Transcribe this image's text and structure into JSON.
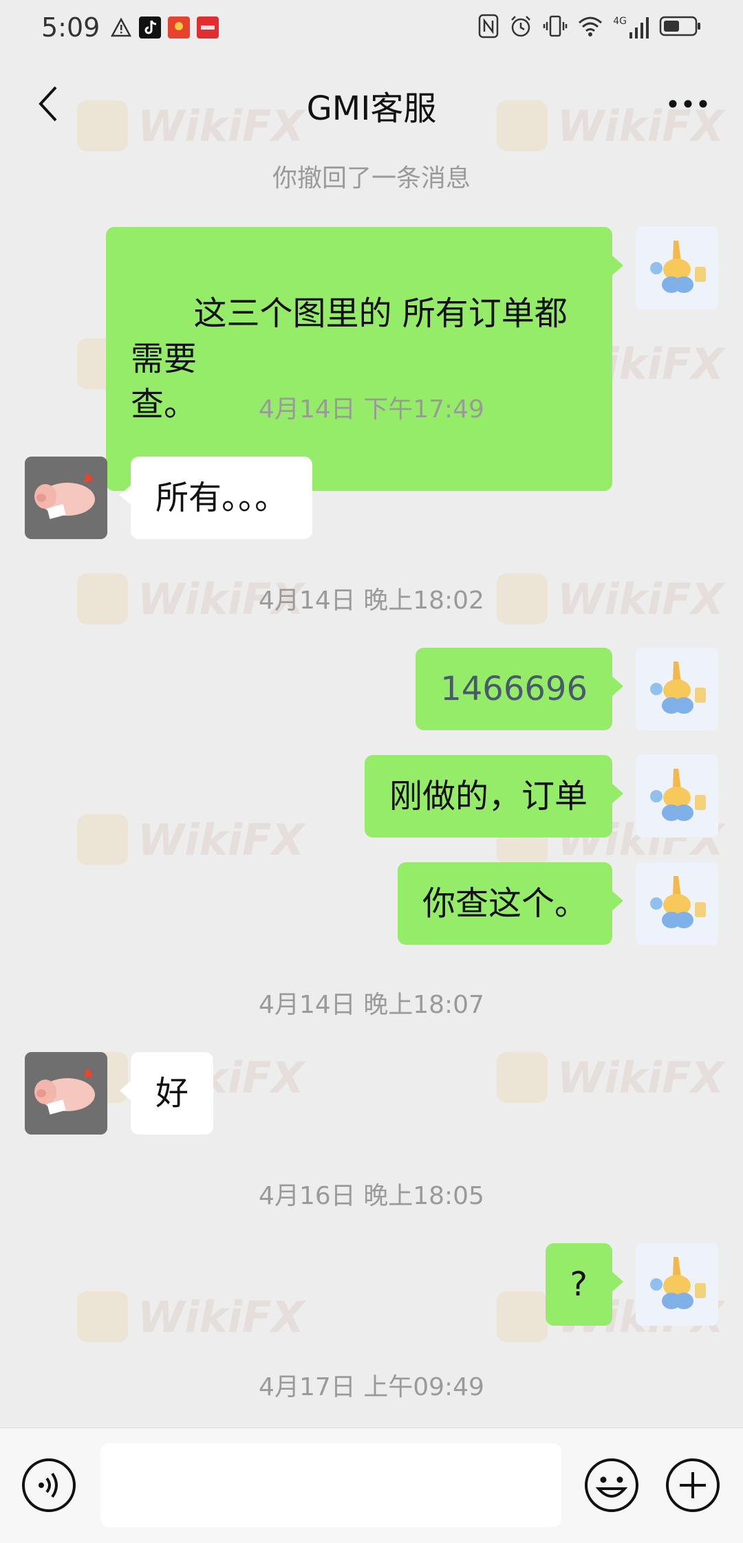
{
  "status_bar": {
    "time": "5:09",
    "icons_left": [
      "warning-icon",
      "tiktok-icon",
      "red-envelope-icon",
      "app-icon"
    ],
    "icons_right": [
      "nfc-icon",
      "alarm-icon",
      "vibrate-icon",
      "wifi-icon",
      "signal-4g-icon",
      "battery-icon"
    ],
    "network_label": "4G"
  },
  "nav": {
    "title": "GMI客服"
  },
  "chat": {
    "recall_notice": "你撤回了一条消息",
    "messages": [
      {
        "side": "self",
        "text": "这三个图里的 所有订单都需要\n查。"
      },
      {
        "side": "timestamp",
        "text": "4月14日 下午17:49"
      },
      {
        "side": "other",
        "text": "所有。。。"
      },
      {
        "side": "timestamp",
        "text": "4月14日 晚上18:02"
      },
      {
        "side": "self",
        "text": "1466696"
      },
      {
        "side": "self",
        "text": "刚做的，订单"
      },
      {
        "side": "self",
        "text": "你查这个。"
      },
      {
        "side": "timestamp",
        "text": "4月14日 晚上18:07"
      },
      {
        "side": "other",
        "text": "好"
      },
      {
        "side": "timestamp",
        "text": "4月16日 晚上18:05"
      },
      {
        "side": "self",
        "text": "?"
      },
      {
        "side": "timestamp",
        "text": "4月17日 上午09:49"
      }
    ]
  },
  "input_bar": {
    "value": "",
    "voice_icon": "voice-icon",
    "emoji_icon": "emoji-icon",
    "plus_icon": "plus-icon"
  },
  "watermark": {
    "text": "WikiFX"
  },
  "colors": {
    "self_bubble": "#95ec69",
    "other_bubble": "#ffffff",
    "background": "#ededed"
  }
}
